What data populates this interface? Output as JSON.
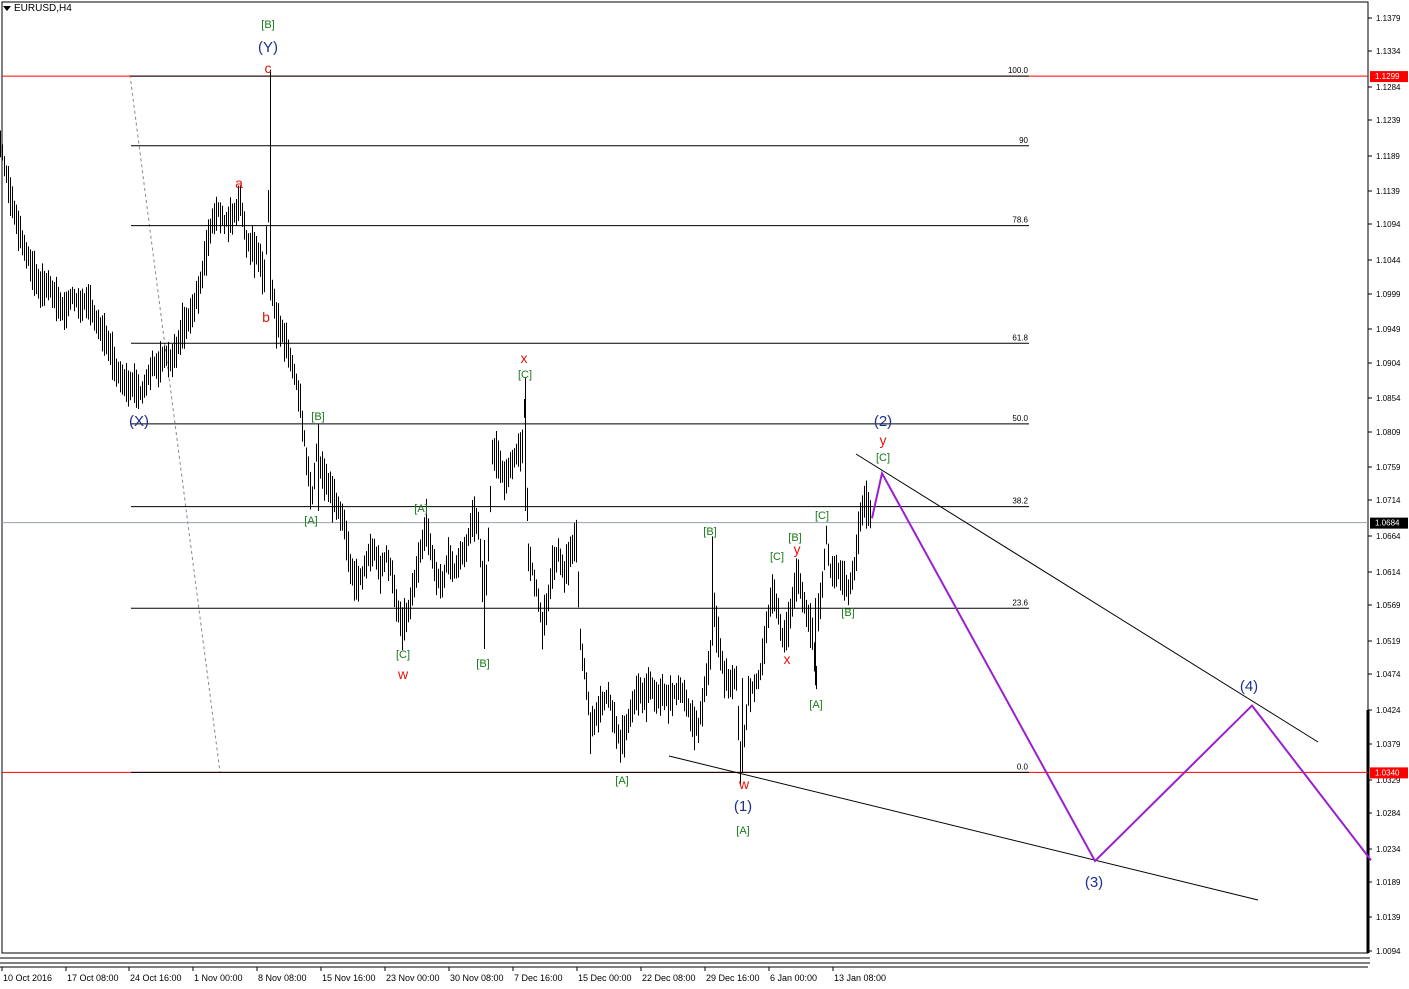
{
  "symbol": "EURUSD,H4",
  "colors": {
    "background": "#ffffff",
    "candle": "#000000",
    "red_line": "#ff0000",
    "wave_red": "#e8120c",
    "wave_green": "#1a7a1a",
    "wave_blue": "#1e2f8c",
    "wave_teal": "#1e88a8",
    "projection": "#9b1fd1",
    "price_tag": "#ff0000",
    "current_tag": "#000000"
  },
  "chart_data": {
    "type": "candlestick",
    "y_ticks": [
      "1.1379",
      "1.1334",
      "1.1284",
      "1.1239",
      "1.1189",
      "1.1139",
      "1.1094",
      "1.1044",
      "1.0999",
      "1.0949",
      "1.0904",
      "1.0854",
      "1.0809",
      "1.0759",
      "1.0714",
      "1.0664",
      "1.0614",
      "1.0569",
      "1.0519",
      "1.0474",
      "1.0424",
      "1.0379",
      "1.0329",
      "1.0284",
      "1.0234",
      "1.0189",
      "1.0139",
      "1.0094"
    ],
    "x_ticks": [
      "10 Oct 2016",
      "17 Oct 08:00",
      "24 Oct 16:00",
      "1 Nov 00:00",
      "8 Nov 08:00",
      "15 Nov 16:00",
      "23 Nov 00:00",
      "30 Nov 08:00",
      "7 Dec 16:00",
      "15 Dec 00:00",
      "22 Dec 08:00",
      "29 Dec 16:00",
      "6 Jan 00:00",
      "13 Jan 08:00"
    ],
    "price_tags": [
      {
        "label": "1.1299",
        "color": "#ff0000"
      },
      {
        "label": "1.0684",
        "color": "#000000"
      },
      {
        "label": "1.0340",
        "color": "#ff0000"
      }
    ],
    "fib_levels": [
      {
        "label": "100.0",
        "price": 1.1299
      },
      {
        "label": "90",
        "price": 1.1203
      },
      {
        "label": "78.6",
        "price": 1.1093
      },
      {
        "label": "61.8",
        "price": 1.0931
      },
      {
        "label": "50.0",
        "price": 1.082
      },
      {
        "label": "38.2",
        "price": 1.0706
      },
      {
        "label": "23.6",
        "price": 1.0566
      },
      {
        "label": "0.0",
        "price": 1.034
      }
    ],
    "wave_labels": [
      {
        "text": "[B]",
        "color": "green"
      },
      {
        "text": "(Y)",
        "color": "blue"
      },
      {
        "text": "c",
        "color": "red"
      },
      {
        "text": "a",
        "color": "red"
      },
      {
        "text": "b",
        "color": "red"
      },
      {
        "text": "(X)",
        "color": "blue"
      },
      {
        "text": "x",
        "color": "red"
      },
      {
        "text": "[C]",
        "color": "green"
      },
      {
        "text": "[B]",
        "color": "green"
      },
      {
        "text": "[A]",
        "color": "green"
      },
      {
        "text": "[A]",
        "color": "green"
      },
      {
        "text": "[C]",
        "color": "green"
      },
      {
        "text": "w",
        "color": "red"
      },
      {
        "text": "[B]",
        "color": "green"
      },
      {
        "text": "[A]",
        "color": "green"
      },
      {
        "text": "[B]",
        "color": "green"
      },
      {
        "text": "[C]",
        "color": "green"
      },
      {
        "text": "y",
        "color": "red"
      },
      {
        "text": "(1)",
        "color": "blue"
      },
      {
        "text": "[A]",
        "color": "green"
      },
      {
        "text": "[C]",
        "color": "green"
      },
      {
        "text": "w",
        "color": "red"
      },
      {
        "text": "[B]",
        "color": "green"
      },
      {
        "text": "x",
        "color": "red"
      },
      {
        "text": "[A]",
        "color": "green"
      },
      {
        "text": "[B]",
        "color": "green"
      },
      {
        "text": "(2)",
        "color": "blue"
      },
      {
        "text": "y",
        "color": "red"
      },
      {
        "text": "[C]",
        "color": "green"
      },
      {
        "text": "(3)",
        "color": "blue"
      },
      {
        "text": "(4)",
        "color": "blue"
      }
    ],
    "price_path": [
      [
        0,
        1.121
      ],
      [
        8,
        1.115
      ],
      [
        16,
        1.11
      ],
      [
        24,
        1.106
      ],
      [
        32,
        1.103
      ],
      [
        40,
        1.1005
      ],
      [
        48,
        1.101
      ],
      [
        56,
        1.099
      ],
      [
        64,
        1.0975
      ],
      [
        72,
        1.1
      ],
      [
        80,
        1.0985
      ],
      [
        88,
        1.099
      ],
      [
        96,
        1.096
      ],
      [
        104,
        1.094
      ],
      [
        110,
        1.092
      ],
      [
        116,
        1.089
      ],
      [
        122,
        1.088
      ],
      [
        128,
        1.087
      ],
      [
        134,
        1.0875
      ],
      [
        140,
        1.086
      ],
      [
        146,
        1.088
      ],
      [
        152,
        1.0905
      ],
      [
        158,
        1.09
      ],
      [
        164,
        1.0915
      ],
      [
        170,
        1.0905
      ],
      [
        176,
        1.092
      ],
      [
        182,
        1.095
      ],
      [
        188,
        1.096
      ],
      [
        194,
        1.098
      ],
      [
        200,
        1.101
      ],
      [
        206,
        1.106
      ],
      [
        212,
        1.11
      ],
      [
        218,
        1.1115
      ],
      [
        224,
        1.11
      ],
      [
        230,
        1.1105
      ],
      [
        236,
        1.1115
      ],
      [
        240,
        1.113
      ],
      [
        246,
        1.107
      ],
      [
        252,
        1.106
      ],
      [
        258,
        1.105
      ],
      [
        264,
        1.102
      ],
      [
        268,
        1.112
      ],
      [
        270,
        1.129
      ],
      [
        272,
        1.1
      ],
      [
        276,
        1.096
      ],
      [
        280,
        1.095
      ],
      [
        286,
        1.093
      ],
      [
        292,
        1.09
      ],
      [
        296,
        1.088
      ],
      [
        300,
        1.085
      ],
      [
        304,
        1.08
      ],
      [
        308,
        1.075
      ],
      [
        312,
        1.072
      ],
      [
        316,
        1.078
      ],
      [
        320,
        1.076
      ],
      [
        326,
        1.074
      ],
      [
        332,
        1.072
      ],
      [
        338,
        1.07
      ],
      [
        344,
        1.068
      ],
      [
        350,
        1.062
      ],
      [
        356,
        1.06
      ],
      [
        362,
        1.061
      ],
      [
        368,
        1.064
      ],
      [
        374,
        1.065
      ],
      [
        380,
        1.062
      ],
      [
        386,
        1.064
      ],
      [
        392,
        1.061
      ],
      [
        396,
        1.057
      ],
      [
        402,
        1.054
      ],
      [
        408,
        1.056
      ],
      [
        414,
        1.06
      ],
      [
        420,
        1.064
      ],
      [
        426,
        1.068
      ],
      [
        430,
        1.065
      ],
      [
        436,
        1.061
      ],
      [
        442,
        1.06
      ],
      [
        448,
        1.064
      ],
      [
        454,
        1.062
      ],
      [
        460,
        1.064
      ],
      [
        466,
        1.065
      ],
      [
        472,
        1.069
      ],
      [
        478,
        1.068
      ],
      [
        484,
        1.056
      ],
      [
        488,
        1.065
      ],
      [
        492,
        1.078
      ],
      [
        498,
        1.077
      ],
      [
        504,
        1.074
      ],
      [
        510,
        1.076
      ],
      [
        516,
        1.078
      ],
      [
        522,
        1.079
      ],
      [
        525,
        1.087
      ],
      [
        528,
        1.064
      ],
      [
        532,
        1.062
      ],
      [
        538,
        1.058
      ],
      [
        542,
        1.054
      ],
      [
        548,
        1.058
      ],
      [
        552,
        1.062
      ],
      [
        558,
        1.064
      ],
      [
        564,
        1.061
      ],
      [
        570,
        1.064
      ],
      [
        576,
        1.066
      ],
      [
        580,
        1.052
      ],
      [
        586,
        1.046
      ],
      [
        590,
        1.04
      ],
      [
        596,
        1.042
      ],
      [
        602,
        1.044
      ],
      [
        608,
        1.045
      ],
      [
        614,
        1.041
      ],
      [
        620,
        1.038
      ],
      [
        626,
        1.04
      ],
      [
        632,
        1.043
      ],
      [
        638,
        1.045
      ],
      [
        644,
        1.044
      ],
      [
        650,
        1.046
      ],
      [
        656,
        1.044
      ],
      [
        662,
        1.045
      ],
      [
        668,
        1.044
      ],
      [
        674,
        1.045
      ],
      [
        680,
        1.046
      ],
      [
        686,
        1.044
      ],
      [
        692,
        1.041
      ],
      [
        698,
        1.04
      ],
      [
        704,
        1.045
      ],
      [
        710,
        1.05
      ],
      [
        714,
        1.056
      ],
      [
        718,
        1.052
      ],
      [
        724,
        1.047
      ],
      [
        730,
        1.046
      ],
      [
        736,
        1.047
      ],
      [
        740,
        1.035
      ],
      [
        744,
        1.039
      ],
      [
        748,
        1.045
      ],
      [
        754,
        1.046
      ],
      [
        760,
        1.048
      ],
      [
        766,
        1.054
      ],
      [
        772,
        1.059
      ],
      [
        778,
        1.056
      ],
      [
        782,
        1.052
      ],
      [
        788,
        1.054
      ],
      [
        794,
        1.059
      ],
      [
        798,
        1.061
      ],
      [
        802,
        1.058
      ],
      [
        806,
        1.056
      ],
      [
        812,
        1.053
      ],
      [
        816,
        1.047
      ],
      [
        818,
        1.056
      ],
      [
        822,
        1.06
      ],
      [
        826,
        1.067
      ],
      [
        830,
        1.062
      ],
      [
        836,
        1.062
      ],
      [
        842,
        1.061
      ],
      [
        848,
        1.059
      ],
      [
        854,
        1.062
      ],
      [
        860,
        1.069
      ],
      [
        864,
        1.071
      ],
      [
        868,
        1.07
      ],
      [
        872,
        1.069
      ]
    ],
    "projection_path": [
      [
        872,
        1.069
      ],
      [
        882,
        1.0752
      ],
      [
        1095,
        1.0218
      ],
      [
        1252,
        1.0432
      ],
      [
        1371,
        1.0219
      ]
    ]
  }
}
